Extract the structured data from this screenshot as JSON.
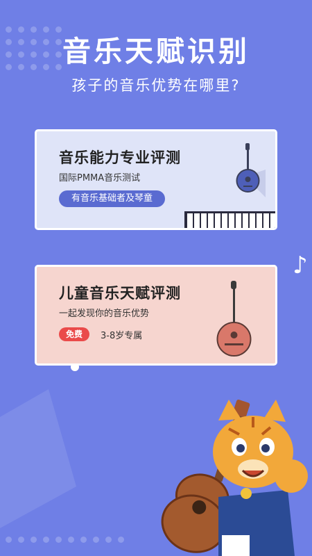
{
  "header": {
    "title": "音乐天赋识别",
    "subtitle": "孩子的音乐优势在哪里?"
  },
  "cards": [
    {
      "title": "音乐能力专业评测",
      "subtitle": "国际PMMA音乐测试",
      "tag": "有音乐基础者及琴童"
    },
    {
      "title": "儿童音乐天赋评测",
      "subtitle": "一起发现你的音乐优势",
      "badge": "免费",
      "tag": "3-8岁专属"
    }
  ],
  "icons": {
    "note": "music-note-icon",
    "card1_art": "ruan-lute-icon",
    "card1_piano": "piano-keys-icon",
    "card2_art": "pipa-lute-icon",
    "mascot": "tiger-guitar-mascot"
  },
  "colors": {
    "background": "#6f7fe6",
    "card1_bg": "#dfe4f8",
    "card2_bg": "#f6d5cf",
    "pill": "#5a6bd1",
    "badge": "#ea4a4a"
  }
}
